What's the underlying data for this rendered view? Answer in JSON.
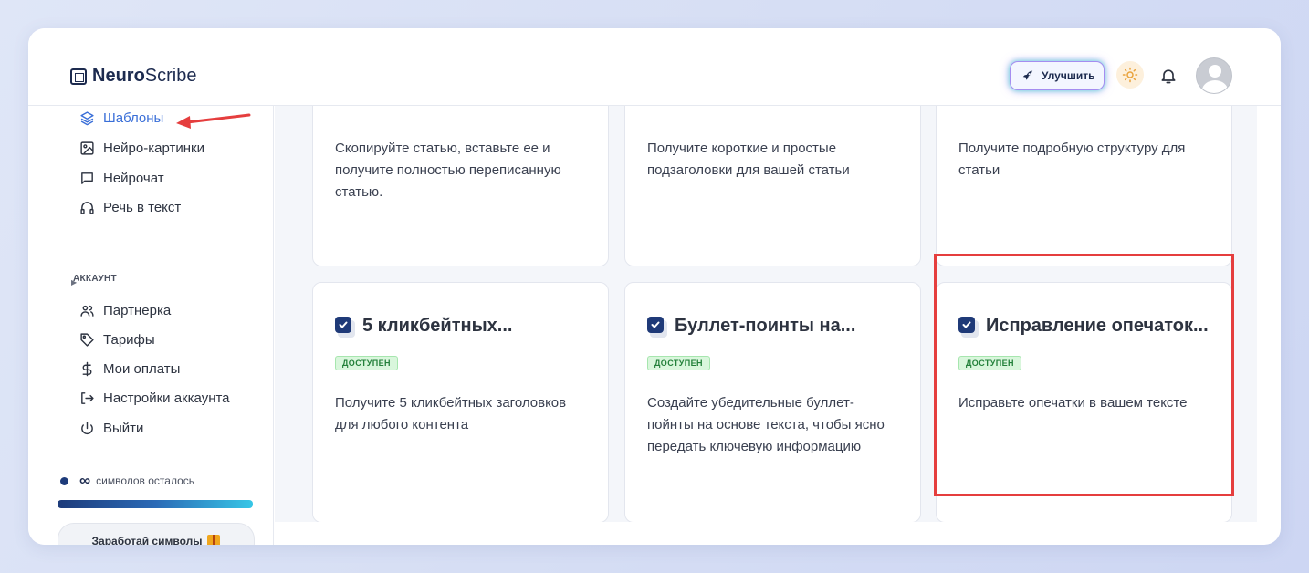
{
  "brand": {
    "bold": "Neuro",
    "light": "Scribe"
  },
  "header": {
    "upgrade_label": "Улучшить"
  },
  "sidebar": {
    "items": [
      {
        "label": "Шаблоны"
      },
      {
        "label": "Нейро-картинки"
      },
      {
        "label": "Нейрочат"
      },
      {
        "label": "Речь в текст"
      }
    ],
    "section_account": "АККАУНТ",
    "account_items": [
      {
        "label": "Партнерка"
      },
      {
        "label": "Тарифы"
      },
      {
        "label": "Мои оплаты"
      },
      {
        "label": "Настройки аккаунта"
      },
      {
        "label": "Выйти"
      }
    ],
    "credits_symbol": "∞",
    "credits_text": "символов осталось",
    "earn_label": "Заработай символы"
  },
  "cards_top": [
    {
      "desc": "Скопируйте статью, вставьте ее и получите полностью переписанную статью."
    },
    {
      "desc": "Получите короткие и простые подзаголовки для вашей статьи"
    },
    {
      "desc": "Получите подробную структуру для статьи"
    }
  ],
  "cards": [
    {
      "title": "5 кликбейтных...",
      "badge": "ДОСТУПЕН",
      "desc": "Получите 5 кликбейтных заголовков для любого контента"
    },
    {
      "title": "Буллет-поинты на...",
      "badge": "ДОСТУПЕН",
      "desc": "Создайте убедительные буллет-пойнты на основе текста, чтобы ясно передать ключевую информацию"
    },
    {
      "title": "Исправление опечаток...",
      "badge": "ДОСТУПЕН",
      "desc": "Исправьте опечатки в вашем тексте"
    }
  ],
  "colors": {
    "accent": "#3a6fd8",
    "highlight": "#e53e3e",
    "brand_dark": "#1d2b4f"
  }
}
